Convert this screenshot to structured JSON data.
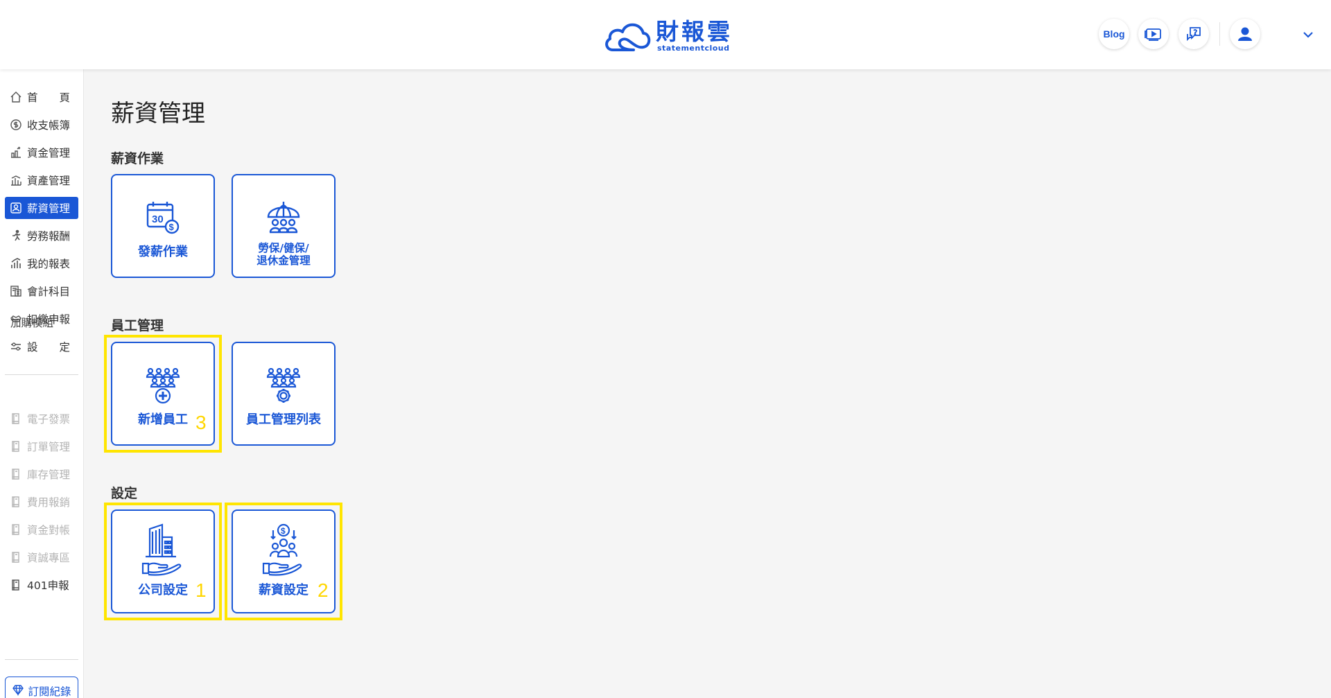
{
  "header": {
    "logo_main": "財報雲",
    "logo_sub": "statementcloud",
    "blog_label": "Blog",
    "icons": [
      "video-tutorial-icon",
      "help-chat-icon",
      "user-avatar-icon",
      "chevron-down-icon"
    ]
  },
  "sidebar": {
    "items": [
      {
        "label": "首頁",
        "icon": "home-icon"
      },
      {
        "label": "收支帳簿",
        "icon": "coin-icon"
      },
      {
        "label": "資金管理",
        "icon": "fund-icon"
      },
      {
        "label": "資產管理",
        "icon": "asset-icon"
      },
      {
        "label": "薪資管理",
        "icon": "payroll-icon",
        "active": true
      },
      {
        "label": "勞務報酬",
        "icon": "labor-icon"
      },
      {
        "label": "我的報表",
        "icon": "report-icon"
      },
      {
        "label": "會計科目",
        "icon": "accounts-icon"
      },
      {
        "label": "扣繳申報",
        "icon": "withholding-icon"
      },
      {
        "label": "設定",
        "icon": "settings-sliders-icon"
      }
    ],
    "addon_title": "加購模組",
    "addons": [
      {
        "label": "電子發票",
        "disabled": true
      },
      {
        "label": "訂單管理",
        "disabled": true
      },
      {
        "label": "庫存管理",
        "disabled": true
      },
      {
        "label": "費用報銷",
        "disabled": true
      },
      {
        "label": "資金對帳",
        "disabled": true
      },
      {
        "label": "資誠專區",
        "disabled": true
      },
      {
        "label": "401申報",
        "disabled": false
      }
    ],
    "subscribe_label": "訂閱紀錄"
  },
  "main": {
    "page_title": "薪資管理",
    "sections": [
      {
        "title": "薪資作業",
        "cards": [
          {
            "label": "發薪作業",
            "icon": "payday-calendar-icon"
          },
          {
            "label_line1": "勞保/健保/",
            "label_line2": "退休金管理",
            "icon": "insurance-umbrella-icon"
          }
        ]
      },
      {
        "title": "員工管理",
        "cards": [
          {
            "label": "新增員工",
            "icon": "add-employee-icon",
            "highlight": "3"
          },
          {
            "label": "員工管理列表",
            "icon": "employee-settings-icon"
          }
        ]
      },
      {
        "title": "設定",
        "cards": [
          {
            "label": "公司設定",
            "icon": "company-building-icon",
            "highlight": "1"
          },
          {
            "label": "薪資設定",
            "icon": "salary-settings-icon",
            "highlight": "2"
          }
        ]
      }
    ]
  },
  "colors": {
    "brand": "#1a57d6",
    "highlight": "#ffe500",
    "highlight_number": "#ffd600"
  }
}
